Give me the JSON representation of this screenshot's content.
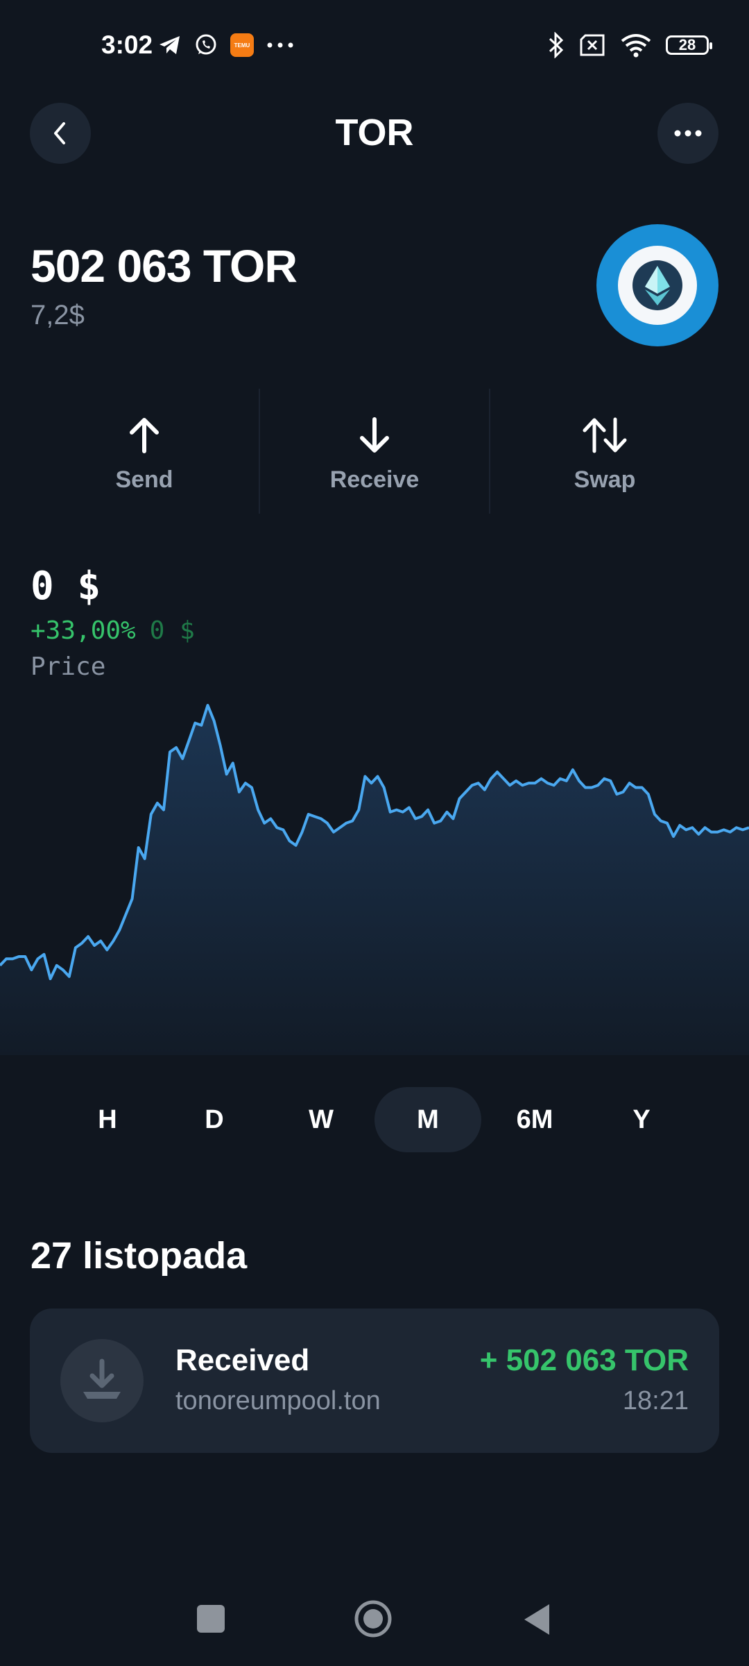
{
  "status": {
    "time": "3:02",
    "battery": "28",
    "icons": [
      "telegram-icon",
      "whatsapp-icon",
      "temu-icon",
      "more-dots-icon",
      "bluetooth-icon",
      "sim-off-icon",
      "wifi-icon",
      "battery-icon"
    ],
    "temu_text": "TEMU"
  },
  "header": {
    "title": "TOR",
    "back_icon": "chevron-left-icon",
    "more_icon": "more-horizontal-icon"
  },
  "balance": {
    "amount": "502 063 TOR",
    "fiat": "7,2$"
  },
  "actions": [
    {
      "label": "Send",
      "icon": "arrow-up-icon"
    },
    {
      "label": "Receive",
      "icon": "arrow-down-icon"
    },
    {
      "label": "Swap",
      "icon": "swap-icon"
    }
  ],
  "price": {
    "value": "0 $",
    "change_pct": "+33,00%",
    "change_abs": "0 $",
    "label": "Price"
  },
  "chart_data": {
    "type": "area",
    "x": [
      0,
      1,
      2,
      3,
      4,
      5,
      6,
      7,
      8,
      9,
      10,
      11,
      12,
      13,
      14,
      15,
      16,
      17,
      18,
      19,
      20,
      21,
      22,
      23,
      24,
      25,
      26,
      27,
      28,
      29,
      30,
      31,
      32,
      33,
      34,
      35,
      36,
      37,
      38,
      39,
      40,
      41,
      42,
      43,
      44,
      45,
      46,
      47,
      48,
      49,
      50,
      51,
      52,
      53,
      54,
      55,
      56,
      57,
      58,
      59,
      60,
      61,
      62,
      63,
      64,
      65,
      66,
      67,
      68,
      69,
      70,
      71,
      72,
      73,
      74,
      75,
      76,
      77,
      78,
      79,
      80,
      81,
      82,
      83,
      84,
      85,
      86,
      87,
      88,
      89,
      90,
      91,
      92,
      93,
      94,
      95,
      96,
      97,
      98,
      99,
      100,
      101,
      102,
      103,
      104,
      105,
      106,
      107,
      108,
      109,
      110,
      111,
      112,
      113,
      114,
      115,
      116,
      117,
      118,
      119
    ],
    "series": [
      {
        "values": [
          20,
          23,
          23,
          24,
          24,
          18,
          23,
          25,
          14,
          20,
          18,
          15,
          28,
          30,
          33,
          29,
          31,
          27,
          31,
          36,
          43,
          50,
          73,
          68,
          88,
          93,
          90,
          116,
          118,
          113,
          121,
          129,
          128,
          137,
          130,
          119,
          106,
          111,
          98,
          102,
          100,
          90,
          84,
          86,
          82,
          81,
          76,
          74,
          80,
          88,
          87,
          86,
          84,
          80,
          82,
          84,
          85,
          90,
          105,
          102,
          105,
          100,
          89,
          90,
          89,
          91,
          86,
          87,
          90,
          84,
          85,
          89,
          86,
          95,
          98,
          101,
          102,
          99,
          104,
          107,
          104,
          101,
          103,
          101,
          102,
          102,
          104,
          102,
          101,
          104,
          103,
          108,
          103,
          100,
          100,
          101,
          104,
          103,
          97,
          98,
          102,
          100,
          100,
          97,
          88,
          85,
          84,
          78,
          83,
          81,
          82,
          79,
          82,
          80,
          80,
          81,
          80,
          82,
          81,
          82
        ]
      }
    ],
    "colors": {
      "line": "#4aa8f0",
      "fill_top": "#1c3552",
      "fill_bottom": "#121b27"
    }
  },
  "periods": {
    "items": [
      "H",
      "D",
      "W",
      "M",
      "6M",
      "Y"
    ],
    "active": "M"
  },
  "history": {
    "date": "27 listopada",
    "tx": {
      "title": "Received",
      "subtitle": "tonoreumpool.ton",
      "amount": "+ 502 063 TOR",
      "time": "18:21",
      "icon": "download-icon"
    }
  },
  "colors": {
    "background": "#10161f",
    "card": "#1d2633",
    "positive": "#36c46b",
    "muted": "#8a94a3",
    "token_ring": "#1a8fd6"
  }
}
